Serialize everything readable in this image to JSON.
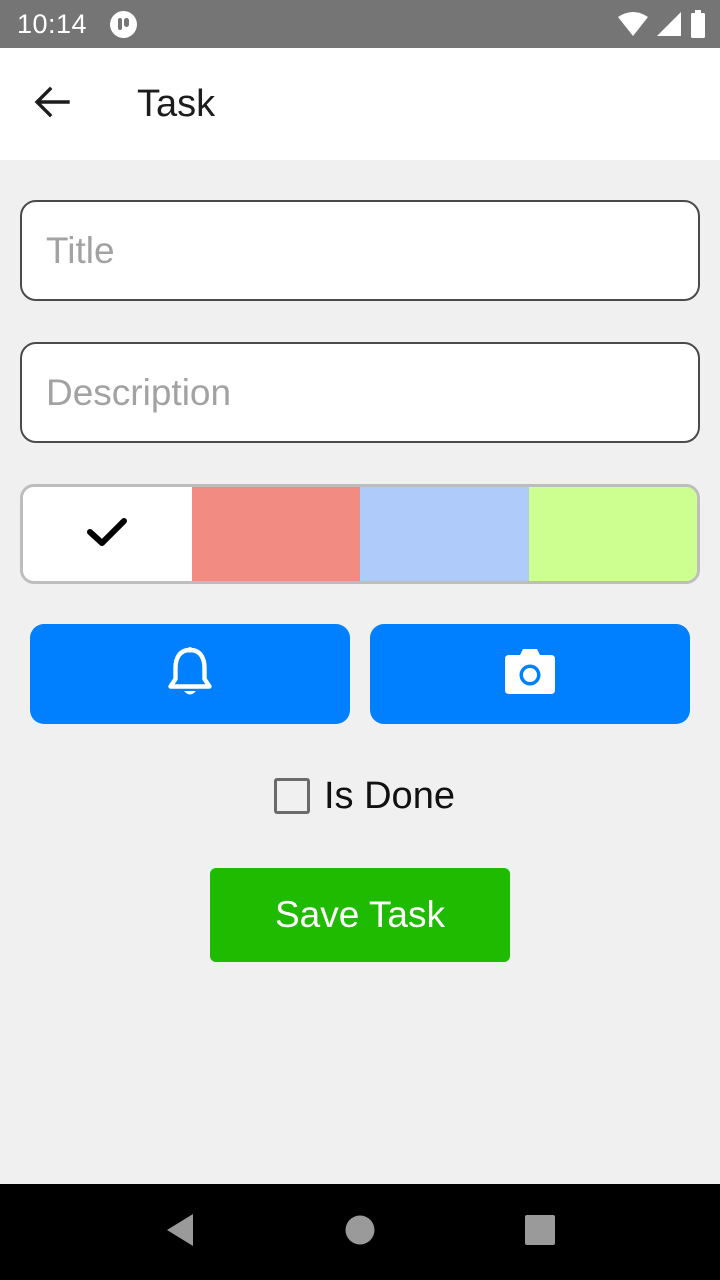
{
  "status_bar": {
    "time": "10:14",
    "icons": [
      "app-notification-icon",
      "wifi-icon",
      "signal-icon",
      "battery-icon"
    ]
  },
  "app_bar": {
    "title": "Task",
    "back_icon": "arrow-left-icon"
  },
  "form": {
    "title_field": {
      "value": "",
      "placeholder": "Title"
    },
    "description_field": {
      "value": "",
      "placeholder": "Description"
    },
    "color_picker": {
      "selected_index": 0,
      "swatches": [
        {
          "color": "#ffffff",
          "selected": true
        },
        {
          "color": "#f28b82",
          "selected": false
        },
        {
          "color": "#aecbfa",
          "selected": false
        },
        {
          "color": "#ccff90",
          "selected": false
        }
      ]
    },
    "reminder_button": {
      "icon": "bell-icon",
      "color": "#0080ff"
    },
    "photo_button": {
      "icon": "camera-icon",
      "color": "#0080ff"
    },
    "is_done": {
      "label": "Is Done",
      "checked": false
    },
    "save_button": {
      "label": "Save Task",
      "color": "#1fbb00"
    }
  },
  "nav_bar": {
    "icons": [
      "back-triangle-icon",
      "home-circle-icon",
      "recents-square-icon"
    ]
  }
}
